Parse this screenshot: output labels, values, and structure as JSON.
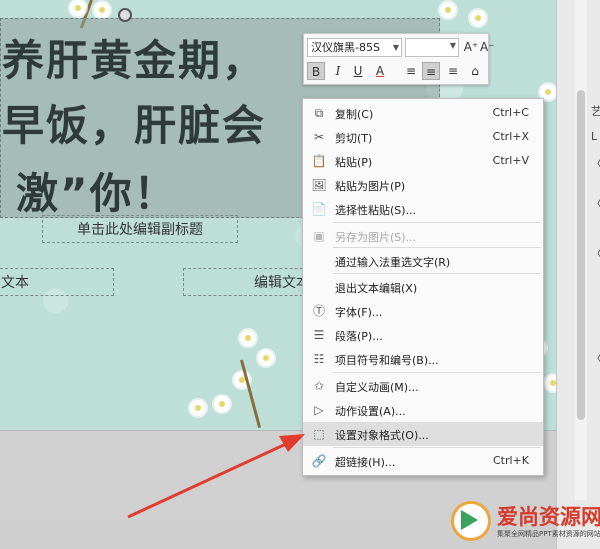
{
  "slide": {
    "title_lines": [
      "养肝黄金期，",
      "早饭，肝脏会",
      "激”你！"
    ],
    "subtitle_placeholder": "单击此处编辑副标题",
    "textbox_left": "文本",
    "textbox_right": "编辑文本"
  },
  "toolbar": {
    "font_name": "汉仪旗黑-85S",
    "font_size": "",
    "buttons": [
      {
        "name": "increase-font-button",
        "glyph": "A⁺"
      },
      {
        "name": "decrease-font-button",
        "glyph": "A⁻"
      },
      {
        "name": "line-spacing-button",
        "glyph": "≡"
      },
      {
        "name": "bold-button",
        "glyph": "B"
      },
      {
        "name": "italic-button",
        "glyph": "I"
      },
      {
        "name": "underline-button",
        "glyph": "U"
      },
      {
        "name": "font-color-button",
        "glyph": "A"
      },
      {
        "name": "align-left-button",
        "glyph": "≡"
      },
      {
        "name": "align-center-button",
        "glyph": "≡"
      },
      {
        "name": "align-right-button",
        "glyph": "≡"
      },
      {
        "name": "format-painter-button",
        "glyph": "⌂"
      }
    ]
  },
  "context_menu": {
    "items": [
      {
        "icon": "copy-icon",
        "glyph": "⧉",
        "label": "复制(C)",
        "shortcut": "Ctrl+C"
      },
      {
        "icon": "scissors-icon",
        "glyph": "✂",
        "label": "剪切(T)",
        "shortcut": "Ctrl+X"
      },
      {
        "icon": "paste-icon",
        "glyph": "📋",
        "label": "粘贴(P)",
        "shortcut": "Ctrl+V"
      },
      {
        "icon": "paste-as-image-icon",
        "glyph": "🖼",
        "label": "粘贴为图片(P)",
        "shortcut": ""
      },
      {
        "icon": "paste-special-icon",
        "glyph": "📄",
        "label": "选择性粘贴(S)...",
        "shortcut": ""
      },
      {
        "icon": "image-icon",
        "glyph": "▣",
        "label": "另存为图片(S)...",
        "shortcut": "",
        "disabled": true
      },
      {
        "icon": "",
        "glyph": "",
        "label": "通过输入法重选文字(R)",
        "shortcut": ""
      },
      {
        "icon": "",
        "glyph": "",
        "label": "退出文本编辑(X)",
        "shortcut": ""
      },
      {
        "icon": "font-icon",
        "glyph": "Ⓣ",
        "label": "字体(F)...",
        "shortcut": ""
      },
      {
        "icon": "paragraph-icon",
        "glyph": "☰",
        "label": "段落(P)...",
        "shortcut": ""
      },
      {
        "icon": "list-icon",
        "glyph": "☷",
        "label": "项目符号和编号(B)...",
        "shortcut": ""
      },
      {
        "icon": "star-animation-icon",
        "glyph": "✩",
        "label": "自定义动画(M)...",
        "shortcut": ""
      },
      {
        "icon": "play-icon",
        "glyph": "▷",
        "label": "动作设置(A)...",
        "shortcut": ""
      },
      {
        "icon": "format-object-icon",
        "glyph": "⬚",
        "label": "设置对象格式(O)...",
        "shortcut": "",
        "highlighted": true
      },
      {
        "icon": "link-icon",
        "glyph": "🔗",
        "label": "超链接(H)...",
        "shortcut": "Ctrl+K"
      }
    ]
  },
  "right_panel": {
    "glyphs": [
      "艺",
      "L",
      "〈",
      "〈",
      "〈",
      "〈"
    ]
  },
  "watermark": {
    "title": "爱尚资源网",
    "subtitle": "集聚全网精品PPT素材资源的网站"
  },
  "colors": {
    "slide_bg": "#bddfd8",
    "menu_bg": "#fafafa",
    "highlight": "#dedede",
    "arrow": "#e23b2e"
  }
}
